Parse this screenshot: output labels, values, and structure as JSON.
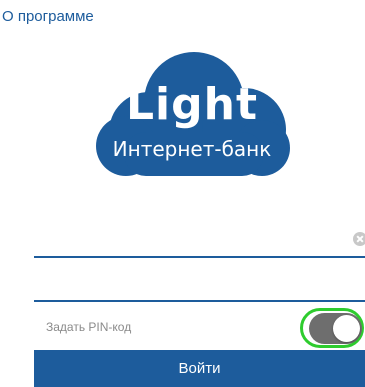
{
  "header": {
    "about_label": "О программе"
  },
  "logo": {
    "title": "Light",
    "subtitle": "Интернет-банк",
    "cloud_color": "#1d5c9c"
  },
  "form": {
    "login_value": "",
    "password_value": "",
    "pin_label": "Задать PIN-код",
    "pin_enabled": true,
    "submit_label": "Войти"
  },
  "colors": {
    "accent": "#1d5c9c",
    "toggle_track": "#6e6e6e",
    "highlight": "#2ecc2e",
    "label_gray": "#8a8a8a"
  },
  "icons": {
    "clear": "clear-icon",
    "toggle": "toggle-switch"
  }
}
